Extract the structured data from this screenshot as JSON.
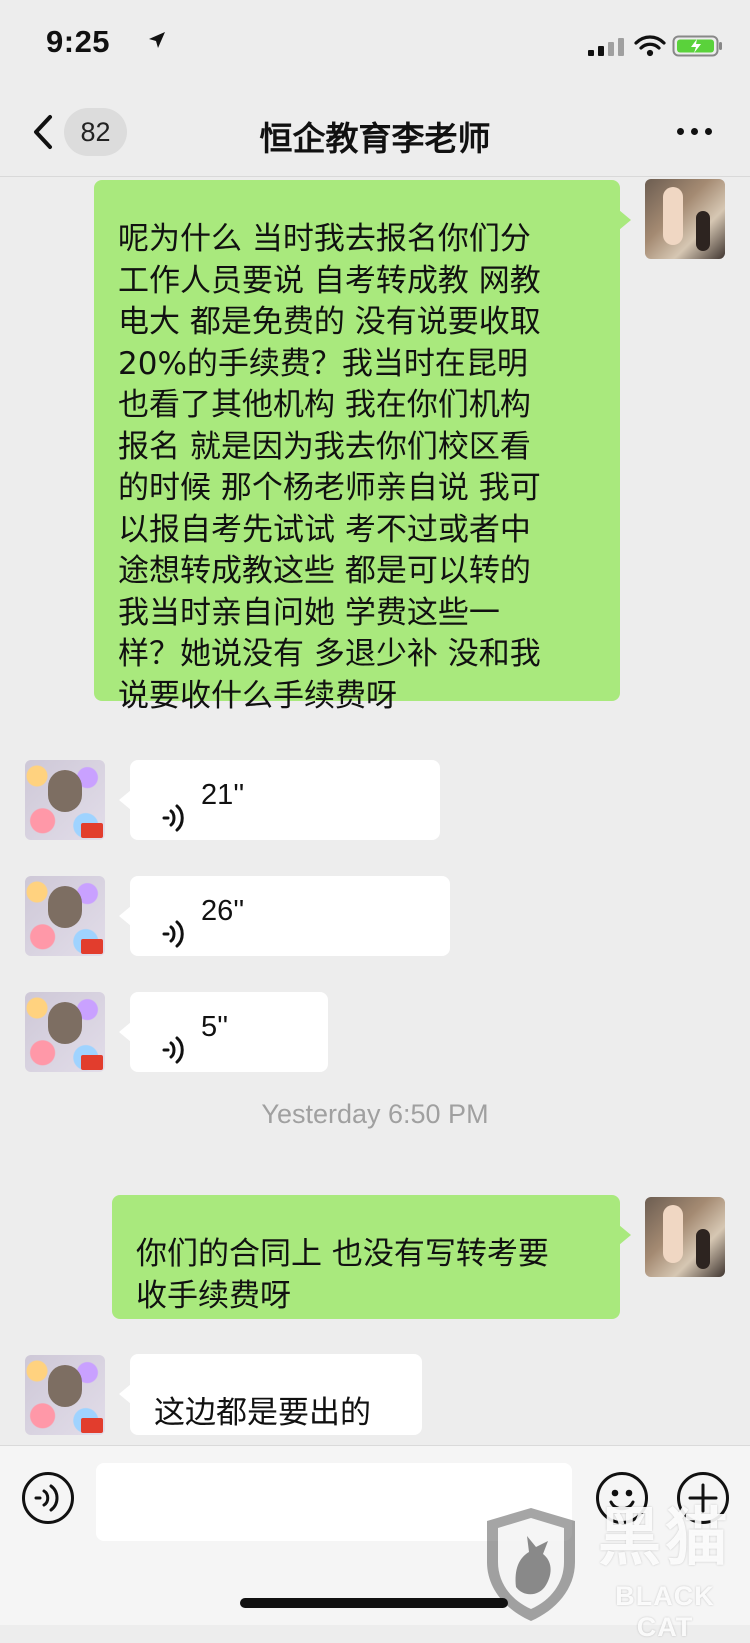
{
  "status_bar": {
    "time": "9:25",
    "location_icon": "location-arrow-icon",
    "signal_icon": "cellular-signal-icon",
    "wifi_icon": "wifi-icon",
    "battery_icon": "battery-charging-icon"
  },
  "header": {
    "back_icon": "chevron-left-icon",
    "unread_count": "82",
    "title": "恒企教育李老师",
    "more_icon": "more-horizontal-icon"
  },
  "messages": [
    {
      "sender": "me",
      "type": "text",
      "text": "呢为什么 当时我去报名你们分\n工作人员要说 自考转成教 网教\n电大 都是免费的 没有说要收取\n20%的手续费？我当时在昆明\n也看了其他机构 我在你们机构\n报名 就是因为我去你们校区看\n的时候 那个杨老师亲自说 我可\n以报自考先试试 考不过或者中\n途想转成教这些 都是可以转的\n我当时亲自问她 学费这些一\n样？她说没有 多退少补 没和我\n说要收什么手续费呀"
    },
    {
      "sender": "them",
      "type": "voice",
      "duration": "21''"
    },
    {
      "sender": "them",
      "type": "voice",
      "duration": "26''"
    },
    {
      "sender": "them",
      "type": "voice",
      "duration": "5''"
    },
    {
      "sender": "system",
      "type": "timestamp",
      "text": "Yesterday 6:50 PM"
    },
    {
      "sender": "me",
      "type": "text",
      "text": "你们的合同上 也没有写转考要\n收手续费呀"
    },
    {
      "sender": "them",
      "type": "text",
      "text": "这边都是要出的"
    }
  ],
  "input_bar": {
    "voice_icon": "voice-input-icon",
    "message_value": "",
    "emoji_icon": "emoji-icon",
    "plus_icon": "plus-icon"
  },
  "watermark": {
    "chinese": "黑猫",
    "english": "BLACK CAT"
  },
  "colors": {
    "page_background": "#ededed",
    "outgoing_bubble": "#a9e97d",
    "incoming_bubble": "#ffffff",
    "timestamp_text": "#a0a0a0",
    "battery_green": "#5ad23b"
  }
}
